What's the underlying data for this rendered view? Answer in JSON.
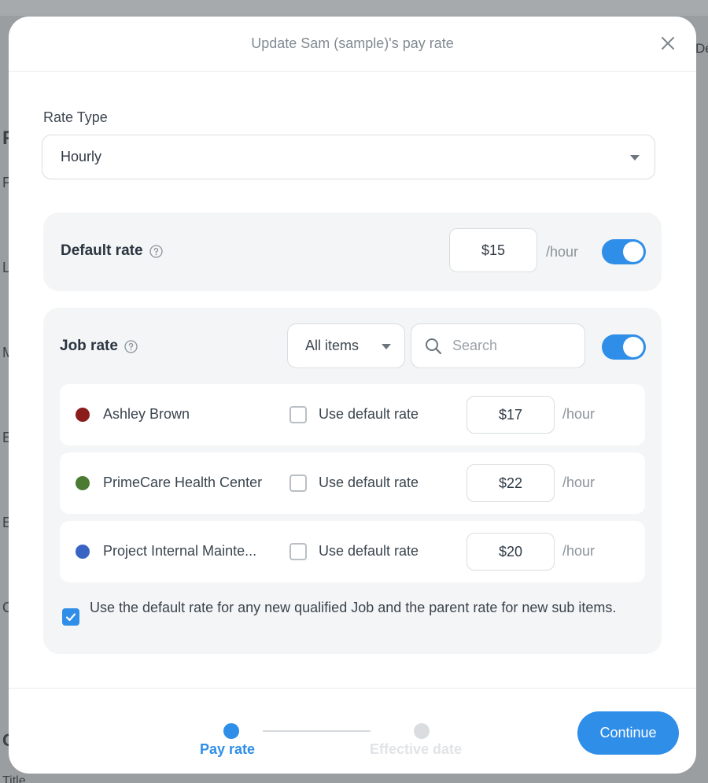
{
  "modal": {
    "title": "Update Sam (sample)'s pay rate",
    "close_icon": "close-icon"
  },
  "background": {
    "letters": [
      "De",
      "F",
      "F",
      "L",
      "M",
      "E",
      "E",
      "C",
      "C",
      "Title"
    ]
  },
  "rate_type": {
    "label": "Rate Type",
    "selected": "Hourly"
  },
  "default_rate": {
    "title": "Default rate",
    "value": "$15",
    "unit": "/hour",
    "enabled": true
  },
  "job_rate": {
    "title": "Job rate",
    "filter": "All items",
    "search_placeholder": "Search",
    "enabled": true,
    "rows": [
      {
        "name": "Ashley Brown",
        "color": "#8b1c1c",
        "use_default_label": "Use default rate",
        "rate": "$17",
        "unit": "/hour"
      },
      {
        "name": "PrimeCare Health Center",
        "color": "#4b7a33",
        "use_default_label": "Use default rate",
        "rate": "$22",
        "unit": "/hour"
      },
      {
        "name": "Project Internal Mainte...",
        "color": "#3a64c4",
        "use_default_label": "Use default rate",
        "rate": "$20",
        "unit": "/hour"
      }
    ],
    "bottom_note": "Use the default rate for any new qualified Job and the parent rate for new sub items."
  },
  "footer": {
    "steps": [
      {
        "label": "Pay rate",
        "active": true
      },
      {
        "label": "Effective date",
        "active": false
      }
    ],
    "continue_label": "Continue"
  },
  "colors": {
    "accent": "#2f8ee8",
    "inactive_step": "#d9dde0"
  }
}
